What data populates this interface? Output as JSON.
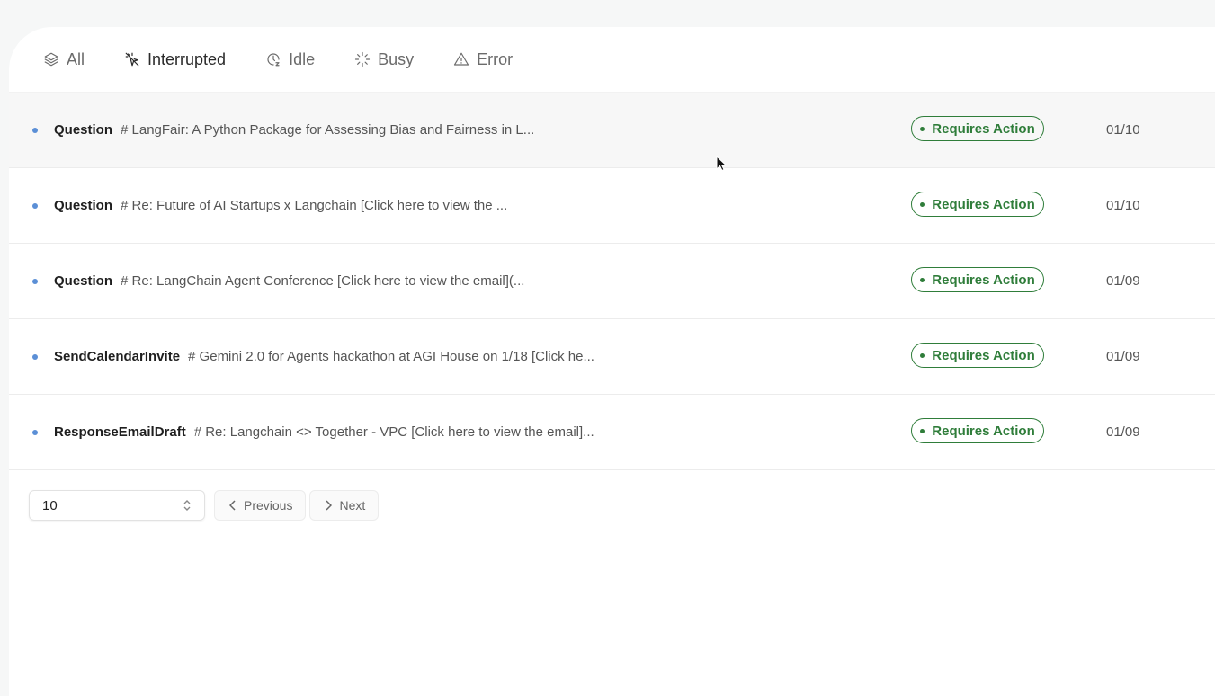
{
  "tabs": [
    {
      "label": "All",
      "icon": "layers-icon",
      "active": false
    },
    {
      "label": "Interrupted",
      "icon": "pointer-off-icon",
      "active": true
    },
    {
      "label": "Idle",
      "icon": "clock-icon",
      "active": false
    },
    {
      "label": "Busy",
      "icon": "loader-icon",
      "active": false
    },
    {
      "label": "Error",
      "icon": "alert-triangle-icon",
      "active": false
    }
  ],
  "rows": [
    {
      "type": "Question",
      "desc": "# LangFair: A Python Package for Assessing Bias and Fairness in L...",
      "status": "Requires Action",
      "date": "01/10"
    },
    {
      "type": "Question",
      "desc": "# Re: Future of AI Startups x Langchain [Click here to view the ...",
      "status": "Requires Action",
      "date": "01/10"
    },
    {
      "type": "Question",
      "desc": "# Re: LangChain Agent Conference [Click here to view the email](...",
      "status": "Requires Action",
      "date": "01/09"
    },
    {
      "type": "SendCalendarInvite",
      "desc": "# Gemini 2.0 for Agents hackathon at AGI House on 1/18 [Click he...",
      "status": "Requires Action",
      "date": "01/09"
    },
    {
      "type": "ResponseEmailDraft",
      "desc": "# Re: Langchain <> Together - VPC [Click here to view the email]...",
      "status": "Requires Action",
      "date": "01/09"
    }
  ],
  "pagination": {
    "page_size": "10",
    "previous_label": "Previous",
    "next_label": "Next"
  },
  "colors": {
    "status_green": "#2f7d3a",
    "unread_dot": "#5b8fd6"
  }
}
